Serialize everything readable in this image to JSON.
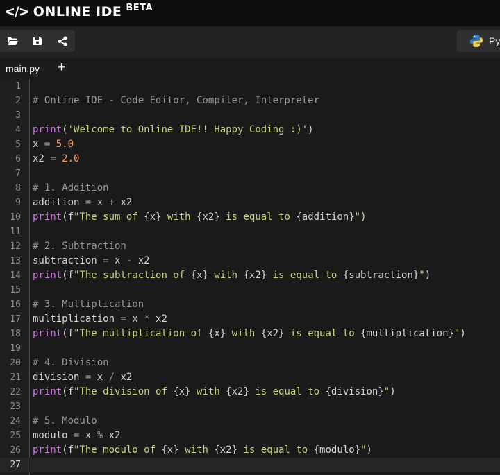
{
  "app": {
    "logo_symbol": "</>",
    "name": "ONLINE IDE",
    "badge": "BETA"
  },
  "toolbar": {
    "buttons": [
      {
        "name": "open-folder-icon",
        "label": "Open"
      },
      {
        "name": "save-icon",
        "label": "Save"
      },
      {
        "name": "share-icon",
        "label": "Share"
      }
    ],
    "language_label": "Py",
    "language_icon": "python-icon"
  },
  "tabs": {
    "items": [
      {
        "label": "main.py"
      }
    ],
    "add_label": "+"
  },
  "colors": {
    "background": "#1a1a1a",
    "comment": "#9a9a9a",
    "function": "#c678dd",
    "string": "#c9d47b",
    "number": "#f59e63"
  },
  "editor": {
    "active_line": 27,
    "lines": [
      [],
      [
        [
          "c",
          "# Online IDE - Code Editor, Compiler, Interpreter"
        ]
      ],
      [],
      [
        [
          "f",
          "print"
        ],
        [
          "p",
          "("
        ],
        [
          "s",
          "'Welcome to Online IDE!! Happy Coding :)'"
        ],
        [
          "p",
          ")"
        ]
      ],
      [
        [
          "p",
          "x "
        ],
        [
          "o",
          "="
        ],
        [
          "p",
          " "
        ],
        [
          "n",
          "5.0"
        ]
      ],
      [
        [
          "p",
          "x2 "
        ],
        [
          "o",
          "="
        ],
        [
          "p",
          " "
        ],
        [
          "n",
          "2.0"
        ]
      ],
      [],
      [
        [
          "c",
          "# 1. Addition"
        ]
      ],
      [
        [
          "p",
          "addition "
        ],
        [
          "o",
          "="
        ],
        [
          "p",
          " x "
        ],
        [
          "o",
          "+"
        ],
        [
          "p",
          " x2"
        ]
      ],
      [
        [
          "f",
          "print"
        ],
        [
          "p",
          "(f"
        ],
        [
          "s",
          "\"The sum of "
        ],
        [
          "p",
          "{x}"
        ],
        [
          "s",
          " with "
        ],
        [
          "p",
          "{x2}"
        ],
        [
          "s",
          " is equal to "
        ],
        [
          "p",
          "{addition}"
        ],
        [
          "s",
          "\""
        ],
        [
          "p",
          ")"
        ]
      ],
      [],
      [
        [
          "c",
          "# 2. Subtraction"
        ]
      ],
      [
        [
          "p",
          "subtraction "
        ],
        [
          "o",
          "="
        ],
        [
          "p",
          " x "
        ],
        [
          "o",
          "-"
        ],
        [
          "p",
          " x2"
        ]
      ],
      [
        [
          "f",
          "print"
        ],
        [
          "p",
          "(f"
        ],
        [
          "s",
          "\"The subtraction of "
        ],
        [
          "p",
          "{x}"
        ],
        [
          "s",
          " with "
        ],
        [
          "p",
          "{x2}"
        ],
        [
          "s",
          " is equal to "
        ],
        [
          "p",
          "{subtraction}"
        ],
        [
          "s",
          "\""
        ],
        [
          "p",
          ")"
        ]
      ],
      [],
      [
        [
          "c",
          "# 3. Multiplication"
        ]
      ],
      [
        [
          "p",
          "multiplication "
        ],
        [
          "o",
          "="
        ],
        [
          "p",
          " x "
        ],
        [
          "o",
          "*"
        ],
        [
          "p",
          " x2"
        ]
      ],
      [
        [
          "f",
          "print"
        ],
        [
          "p",
          "(f"
        ],
        [
          "s",
          "\"The multiplication of "
        ],
        [
          "p",
          "{x}"
        ],
        [
          "s",
          " with "
        ],
        [
          "p",
          "{x2}"
        ],
        [
          "s",
          " is equal to "
        ],
        [
          "p",
          "{multiplication}"
        ],
        [
          "s",
          "\""
        ],
        [
          "p",
          ")"
        ]
      ],
      [],
      [
        [
          "c",
          "# 4. Division"
        ]
      ],
      [
        [
          "p",
          "division "
        ],
        [
          "o",
          "="
        ],
        [
          "p",
          " x "
        ],
        [
          "o",
          "/"
        ],
        [
          "p",
          " x2"
        ]
      ],
      [
        [
          "f",
          "print"
        ],
        [
          "p",
          "(f"
        ],
        [
          "s",
          "\"The division of "
        ],
        [
          "p",
          "{x}"
        ],
        [
          "s",
          " with "
        ],
        [
          "p",
          "{x2}"
        ],
        [
          "s",
          " is equal to "
        ],
        [
          "p",
          "{division}"
        ],
        [
          "s",
          "\""
        ],
        [
          "p",
          ")"
        ]
      ],
      [],
      [
        [
          "c",
          "# 5. Modulo"
        ]
      ],
      [
        [
          "p",
          "modulo "
        ],
        [
          "o",
          "="
        ],
        [
          "p",
          " x "
        ],
        [
          "o",
          "%"
        ],
        [
          "p",
          " x2"
        ]
      ],
      [
        [
          "f",
          "print"
        ],
        [
          "p",
          "(f"
        ],
        [
          "s",
          "\"The modulo of "
        ],
        [
          "p",
          "{x}"
        ],
        [
          "s",
          " with "
        ],
        [
          "p",
          "{x2}"
        ],
        [
          "s",
          " is equal to "
        ],
        [
          "p",
          "{modulo}"
        ],
        [
          "s",
          "\""
        ],
        [
          "p",
          ")"
        ]
      ],
      []
    ]
  }
}
